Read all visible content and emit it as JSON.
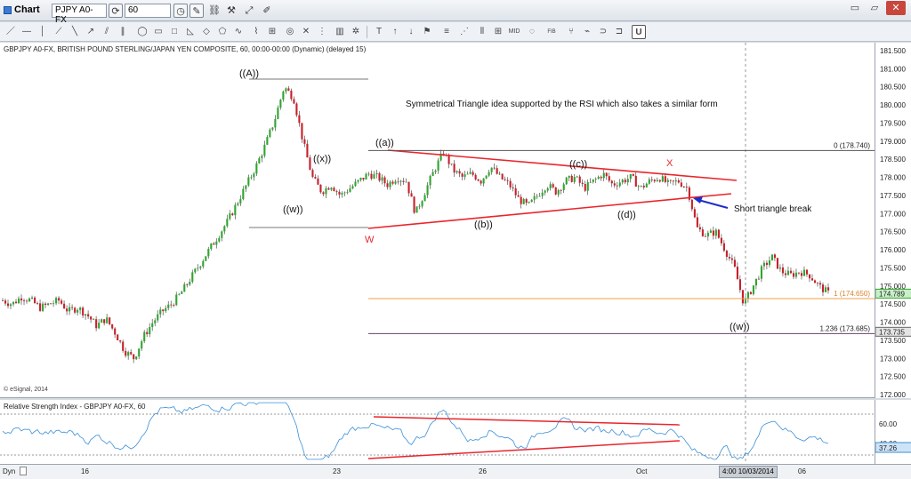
{
  "window": {
    "title": "Chart",
    "symbol": "PJPY A0-FX",
    "interval": "60",
    "toolbar_icons": [
      "refresh-icon",
      "clock-icon",
      "pencil-icon",
      "link-icon",
      "wrench-icon"
    ],
    "window_controls": [
      "minimize-icon",
      "maximize-icon",
      "close-icon"
    ]
  },
  "drawing_toolbar": {
    "tools": [
      "line-icon",
      "hline-icon",
      "vline-icon",
      "ray-icon",
      "channel-icon",
      "rect-icon",
      "ellipse-icon",
      "arc-icon",
      "text-icon",
      "arrow-up-icon",
      "arrow-down-icon",
      "fib-icon",
      "grid-icon",
      "fib-fan-icon",
      "mid-icon",
      "cycle-icon",
      "pitchfork-icon",
      "wave-icon",
      "magnet-icon",
      "u-icon"
    ],
    "text_tools": [
      "MID",
      "FIB EXT",
      "T"
    ]
  },
  "price_pane": {
    "caption": "GBPJPY A0-FX, BRITISH POUND STERLING/JAPAN YEN COMPOSITE, 60, 00:00-00:00 (Dynamic) (delayed 15)",
    "copyright": "© eSignal, 2014",
    "annotation_text": "Symmetrical Triangle idea supported by the RSI which also takes a similar form",
    "break_label": "Short triangle break",
    "wave_labels": [
      "((A))",
      "((x))",
      "((w))",
      "((a))",
      "((b))",
      "((c))",
      "((d))",
      "((w))"
    ],
    "point_labels": [
      "W",
      "X"
    ],
    "fib_levels": [
      {
        "label": "0 (178.740)",
        "value": 178.74,
        "color": "#555555"
      },
      {
        "label": "1 (174.650)",
        "value": 174.65,
        "color": "#f0a24a"
      },
      {
        "label": "1.236 (173.685)",
        "value": 173.685,
        "color": "#6b3f6b"
      }
    ],
    "last_price": "174.789",
    "marker_price": "173.735",
    "y_ticks": [
      "181.500",
      "181.000",
      "180.500",
      "180.000",
      "179.500",
      "179.000",
      "178.500",
      "178.000",
      "177.500",
      "177.000",
      "176.500",
      "176.000",
      "175.500",
      "175.000",
      "174.500",
      "174.000",
      "173.500",
      "173.000",
      "172.500",
      "172.000"
    ]
  },
  "rsi_pane": {
    "caption": "Relative Strength Index - GBPJPY A0-FX, 60",
    "y_ticks": [
      "60.00",
      "40.00"
    ],
    "last_value": "37.26"
  },
  "time_axis": {
    "mode": "Dyn",
    "labels": [
      "16",
      "23",
      "26",
      "Oct",
      "06"
    ],
    "cursor_time": "4:00 10/03/2014"
  },
  "chart_data": {
    "type": "candlestick",
    "title": "GBPJPY A0-FX, BRITISH POUND STERLING/JAPAN YEN COMPOSITE, 60",
    "ylim": [
      172.0,
      181.5
    ],
    "x": [
      "16",
      "23",
      "26",
      "Oct",
      "06"
    ],
    "close_path": [
      174.6,
      174.5,
      174.7,
      174.6,
      174.4,
      174.5,
      174.6,
      174.3,
      174.4,
      174.2,
      173.9,
      174.1,
      173.7,
      173.2,
      173.0,
      173.6,
      174.0,
      174.3,
      174.5,
      174.8,
      175.2,
      175.6,
      176.0,
      176.4,
      176.8,
      177.3,
      177.8,
      178.3,
      178.9,
      179.6,
      180.5,
      180.2,
      179.0,
      178.0,
      177.6,
      177.8,
      177.5,
      177.7,
      177.9,
      178.1,
      178.0,
      177.8,
      178.0,
      177.9,
      177.0,
      177.6,
      178.2,
      178.7,
      178.2,
      178.0,
      178.1,
      177.9,
      178.3,
      178.0,
      177.8,
      177.4,
      177.2,
      177.5,
      177.8,
      177.6,
      177.9,
      178.0,
      177.7,
      177.9,
      178.1,
      177.8,
      177.9,
      178.0,
      177.7,
      177.9,
      178.0,
      177.8,
      177.9,
      177.7,
      176.6,
      176.4,
      176.5,
      176.0,
      175.5,
      174.5,
      175.0,
      175.5,
      175.8,
      175.4,
      175.3,
      175.4,
      175.3,
      175.0,
      174.8
    ],
    "fib_levels": [
      178.74,
      174.65,
      173.685
    ],
    "rsi_ylim": [
      20,
      80
    ],
    "rsi_ticks": [
      60,
      40
    ],
    "rsi_last": 37.26
  },
  "colors": {
    "bull": "#2fa52f",
    "bear": "#c8202a",
    "triangle": "#e8262c",
    "arrow": "#1c2ec9",
    "rsi_line": "#3a8fd9"
  }
}
